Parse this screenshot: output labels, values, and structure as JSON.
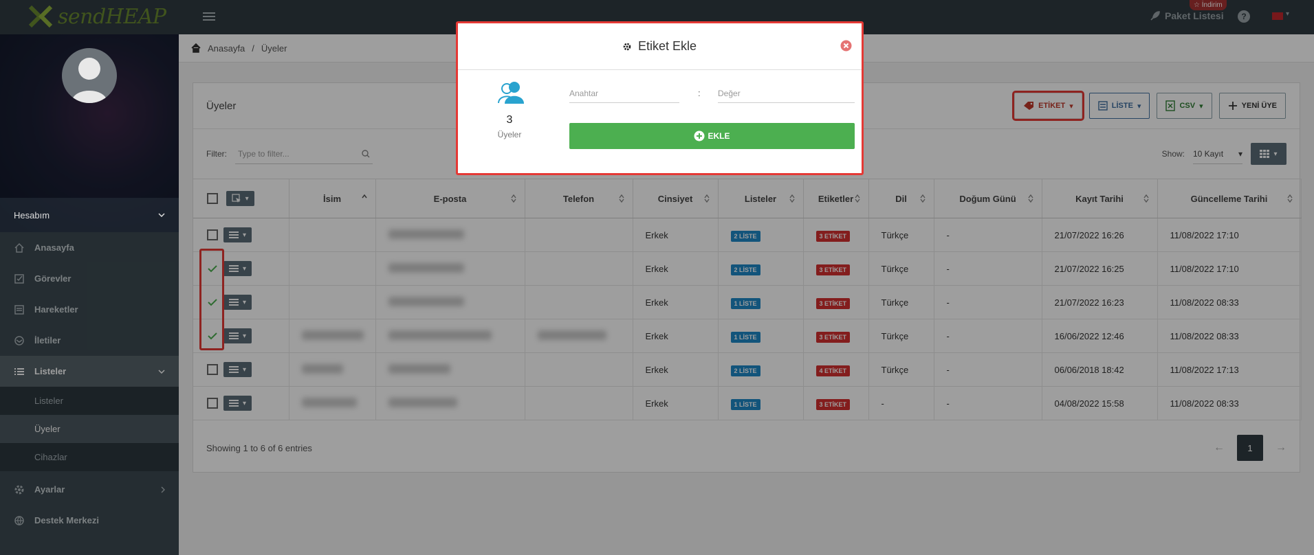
{
  "brand": {
    "name": "sendHEAP"
  },
  "topbar": {
    "promo": "☆ İndirim",
    "packages": "Paket Listesi",
    "help": "?"
  },
  "sidebar": {
    "account": "Hesabım",
    "items": [
      {
        "label": "Anasayfa",
        "icon": "home-icon"
      },
      {
        "label": "Görevler",
        "icon": "checkbox-icon"
      },
      {
        "label": "Hareketler",
        "icon": "activity-icon"
      },
      {
        "label": "İletiler",
        "icon": "mail-icon"
      },
      {
        "label": "Listeler",
        "icon": "list-icon"
      }
    ],
    "sub_items": [
      "Listeler",
      "Üyeler",
      "Cihazlar"
    ],
    "bottom": [
      {
        "label": "Ayarlar",
        "icon": "gear-icon"
      },
      {
        "label": "Destek Merkezi",
        "icon": "globe-icon"
      }
    ]
  },
  "breadcrumb": {
    "home": "Anasayfa",
    "sep": "/",
    "current": "Üyeler"
  },
  "card": {
    "title": "Üyeler",
    "buttons": {
      "etiket": "ETİKET",
      "liste": "LİSTE",
      "csv": "CSV",
      "yeni": "YENİ ÜYE"
    },
    "filter_label": "Filter:",
    "filter_placeholder": "Type to filter...",
    "show_label": "Show:",
    "show_value": "10 Kayıt"
  },
  "table": {
    "columns": [
      "İsim",
      "E-posta",
      "Telefon",
      "Cinsiyet",
      "Listeler",
      "Etiketler",
      "Dil",
      "Doğum Günü",
      "Kayıt Tarihi",
      "Güncelleme Tarihi"
    ],
    "rows": [
      {
        "checked": false,
        "gender": "Erkek",
        "lists": "2 LİSTE",
        "tags": "3 ETİKET",
        "lang": "Türkçe",
        "birthday": "-",
        "created": "21/07/2022 16:26",
        "updated": "11/08/2022 17:10"
      },
      {
        "checked": true,
        "gender": "Erkek",
        "lists": "2 LİSTE",
        "tags": "3 ETİKET",
        "lang": "Türkçe",
        "birthday": "-",
        "created": "21/07/2022 16:25",
        "updated": "11/08/2022 17:10"
      },
      {
        "checked": true,
        "gender": "Erkek",
        "lists": "1 LİSTE",
        "tags": "3 ETİKET",
        "lang": "Türkçe",
        "birthday": "-",
        "created": "21/07/2022 16:23",
        "updated": "11/08/2022 08:33"
      },
      {
        "checked": true,
        "gender": "Erkek",
        "lists": "1 LİSTE",
        "tags": "3 ETİKET",
        "lang": "Türkçe",
        "birthday": "-",
        "created": "16/06/2022 12:46",
        "updated": "11/08/2022 08:33"
      },
      {
        "checked": false,
        "gender": "Erkek",
        "lists": "2 LİSTE",
        "tags": "4 ETİKET",
        "lang": "Türkçe",
        "birthday": "-",
        "created": "06/06/2018 18:42",
        "updated": "11/08/2022 17:13"
      },
      {
        "checked": false,
        "gender": "Erkek",
        "lists": "1 LİSTE",
        "tags": "3 ETİKET",
        "lang": "-",
        "birthday": "-",
        "created": "04/08/2022 15:58",
        "updated": "11/08/2022 08:33"
      }
    ],
    "footer": "Showing 1 to 6 of 6 entries",
    "page": "1",
    "prev": "←",
    "next": "→"
  },
  "modal": {
    "title": "Etiket Ekle",
    "count": "3",
    "count_label": "Üyeler",
    "key_placeholder": "Anahtar",
    "colon": ":",
    "value_placeholder": "Değer",
    "add_button": "EKLE"
  },
  "colors": {
    "accent_red": "#e53935",
    "green": "#4caf50",
    "blue_badge": "#1e88c7",
    "red_badge": "#d32f2f",
    "sidebar": "#3c4a51"
  }
}
